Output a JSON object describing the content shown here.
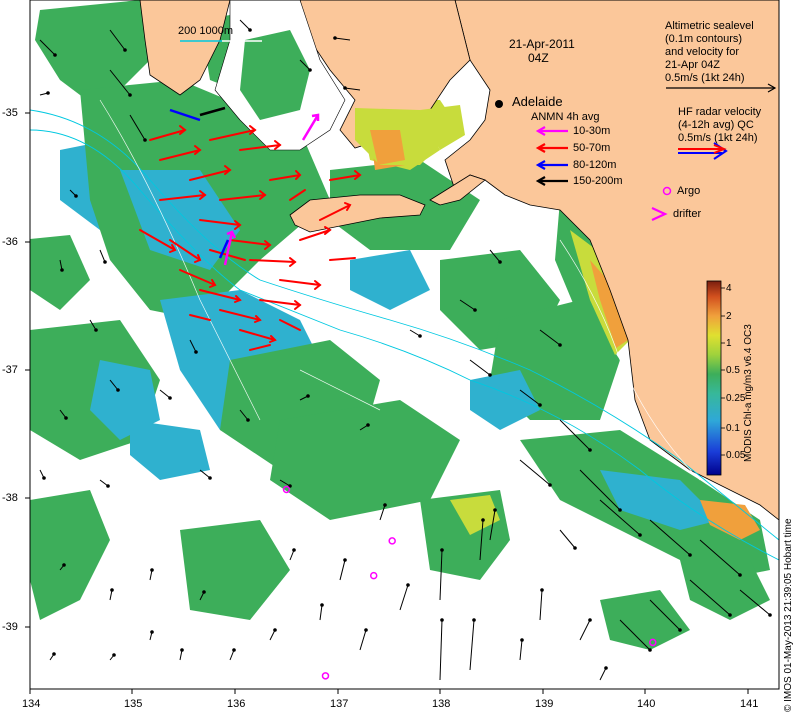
{
  "header": {
    "date": "21-Apr-2011",
    "time": "04Z",
    "scale_bar_label": "200  1000m"
  },
  "place": {
    "city": "Adelaide"
  },
  "sealevel_legend": {
    "lines": [
      "Altimetric sealevel",
      "(0.1m contours)",
      "and velocity for",
      "21-Apr 04Z",
      "0.5m/s (1kt 24h)"
    ]
  },
  "hf_radar_legend": {
    "lines": [
      "HF radar velocity",
      "(4-12h avg) QC",
      "0.5m/s (1kt 24h)"
    ]
  },
  "anmn_legend": {
    "title": "ANMN 4h avg",
    "items": [
      {
        "label": "10-30m",
        "color": "#ff00ff"
      },
      {
        "label": "50-70m",
        "color": "#ff0000"
      },
      {
        "label": "80-120m",
        "color": "#0000ff"
      },
      {
        "label": "150-200m",
        "color": "#000000"
      }
    ]
  },
  "markers_legend": {
    "argo": "Argo",
    "drifter": "drifter"
  },
  "colorbar": {
    "title": "MODIS Chl-a mg/m3 v6.4 OC3",
    "ticks": [
      "4",
      "2",
      "1",
      "0.5",
      "0.25",
      "0.1",
      "0.05"
    ]
  },
  "axes": {
    "x_ticks": [
      "134",
      "135",
      "136",
      "137",
      "138",
      "139",
      "140",
      "141"
    ],
    "y_ticks": [
      "-35",
      "-36",
      "-37",
      "-38",
      "-39"
    ]
  },
  "credit": "© IMOS 01-May-2013 21:39:05 Hobart time",
  "colors": {
    "land": "#fbc79a",
    "chl_green": "#3dae5a",
    "chl_cyan": "#2fb1cf",
    "chl_yellow": "#c8dc3c",
    "chl_orange": "#f0a03c",
    "hf_radar": "#ff0000",
    "argo": "#ff00ff"
  },
  "argo_floats": [
    {
      "lon": 136.5,
      "lat": -37.93
    },
    {
      "lon": 137.53,
      "lat": -38.33
    },
    {
      "lon": 137.35,
      "lat": -38.6
    },
    {
      "lon": 136.88,
      "lat": -39.38
    },
    {
      "lon": 140.07,
      "lat": -39.12
    }
  ]
}
